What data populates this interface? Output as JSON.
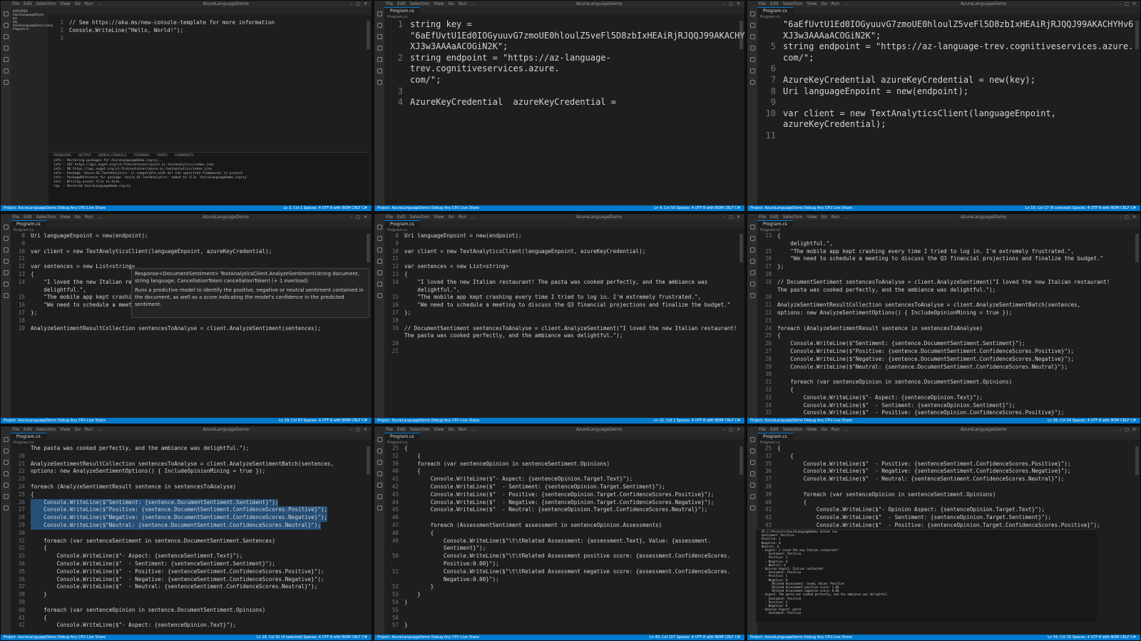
{
  "app": {
    "menu": [
      "File",
      "Edit",
      "Selection",
      "View",
      "Go",
      "Run",
      "..."
    ],
    "window_title": "AzureLanguageDemo",
    "file_tab": "Program.cs",
    "breadcrumb": "Program.cs"
  },
  "panes": [
    {
      "font": "small",
      "status_left": "Project: AzureLanguageDemo   Debug Any CPU   Live Share",
      "status_right": "Ln 3, Col 1   Spaces: 4   UTF-8 with BOM   CRLF   C#",
      "lines": [
        {
          "n": "1",
          "t": "// See https://aka.ms/new-console-template for more information"
        },
        {
          "n": "2",
          "t": "Console.WriteLine(\"Hello, World!\");"
        },
        {
          "n": "3",
          "t": ""
        }
      ]
    },
    {
      "font": "big",
      "status_left": "Project: AzureLanguageDemo   Debug Any CPU   Live Share",
      "status_right": "Ln 4, Col 50   Spaces: 4   UTF-8 with BOM   CRLF   C#",
      "lines": [
        {
          "n": "1",
          "t": "string key ="
        },
        {
          "n": "",
          "t": "\"6aEfUvtU1Ed0IOGyuuvG7zmoUE0hloulZ5veFl5D8zbIxHEAiRjRJQQJ99AKACHYHv6"
        },
        {
          "n": "",
          "t": "XJ3w3AAAaACOGiN2K\";"
        },
        {
          "n": "2",
          "t": "string endpoint = \"https://az-language-trev.cognitiveservices.azure."
        },
        {
          "n": "",
          "t": "com/\";"
        },
        {
          "n": "3",
          "t": ""
        },
        {
          "n": "4",
          "t": "AzureKeyCredential  azureKeyCredential = "
        }
      ]
    },
    {
      "font": "big",
      "status_left": "Project: AzureLanguageDemo   Debug Any CPU   Live Share",
      "status_right": "Ln 10, Col 17 (6 selected)   Spaces: 4   UTF-8 with BOM   CRLF   C#",
      "lines": [
        {
          "n": "",
          "t": "\"6aEfUvtU1Ed0IOGyuuvG7zmoUE0hloulZ5veFl5D8zbIxHEAiRjRJQQJ99AKACHYHv6"
        },
        {
          "n": "",
          "t": "XJ3w3AAAaACOGiN2K\";"
        },
        {
          "n": "5",
          "t": "string endpoint = \"https://az-language-trev.cognitiveservices.azure."
        },
        {
          "n": "",
          "t": "com/\";"
        },
        {
          "n": "6",
          "t": ""
        },
        {
          "n": "7",
          "t": "AzureKeyCredential azureKeyCredential = new(key);"
        },
        {
          "n": "8",
          "t": "Uri languageEnpoint = new(endpoint);"
        },
        {
          "n": "9",
          "t": ""
        },
        {
          "n": "10",
          "t": "var client = new TextAnalyticsClient(languageEnpoint,"
        },
        {
          "n": "",
          "t": "azureKeyCredential);"
        },
        {
          "n": "11",
          "t": ""
        }
      ]
    },
    {
      "font": "small",
      "status_left": "Project: AzureLanguageDemo   Debug Any CPU   Live Share",
      "status_right": "Ln 19, Col 97   Spaces: 4   UTF-8 with BOM   CRLF   C#",
      "lines": [
        {
          "n": "8",
          "t": "Uri languageEnpoint = new(endpoint);"
        },
        {
          "n": "9",
          "t": ""
        },
        {
          "n": "10",
          "t": "var client = new TextAnalyticsClient(languageEnpoint, azureKeyCredential);"
        },
        {
          "n": "11",
          "t": ""
        },
        {
          "n": "12",
          "t": "var sentences = new List<string>"
        },
        {
          "n": "13",
          "t": "{"
        },
        {
          "n": "14",
          "t": "    \"I loved the new Italian res"
        },
        {
          "n": "",
          "t": "    delightful.\","
        },
        {
          "n": "15",
          "t": "    \"The mobile app kept crashir"
        },
        {
          "n": "16",
          "t": "    \"We need to schedule a meeti"
        },
        {
          "n": "17",
          "t": "};"
        },
        {
          "n": "18",
          "t": ""
        },
        {
          "n": "19",
          "t": "AnalyzeSentimentResultCollection sentencesToAnalyse = client.AnalyzeSentiment(sentences);"
        }
      ]
    },
    {
      "font": "small",
      "status_left": "Project: AzureLanguageDemo   Debug Any CPU   Live Share",
      "status_right": "Ln 21, Col 1   Spaces: 4   UTF-8 with BOM   CRLF   C#",
      "lines": [
        {
          "n": "8",
          "t": "Uri languageEnpoint = new(endpoint);"
        },
        {
          "n": "9",
          "t": ""
        },
        {
          "n": "10",
          "t": "var client = new TextAnalyticsClient(languageEnpoint, azureKeyCredential);"
        },
        {
          "n": "11",
          "t": ""
        },
        {
          "n": "12",
          "t": "var sentences = new List<string>"
        },
        {
          "n": "13",
          "t": "{"
        },
        {
          "n": "14",
          "t": "    \"I loved the new Italian restaurant! The pasta was cooked perfectly, and the ambiance was"
        },
        {
          "n": "",
          "t": "    delightful.\","
        },
        {
          "n": "15",
          "t": "    \"The mobile app kept crashing every time I tried to log in. I'm extremely frustrated.\","
        },
        {
          "n": "16",
          "t": "    \"We need to schedule a meeting to discuss the Q3 financial projections and finalize the budget.\""
        },
        {
          "n": "17",
          "t": "};"
        },
        {
          "n": "18",
          "t": ""
        },
        {
          "n": "19",
          "t": "// DocumentSentiment sentencesToAnalyse = client.AnalyzeSentiment(\"I loved the new Italian restaurant!"
        },
        {
          "n": "",
          "t": "The pasta was cooked perfectly, and the ambiance was delightful.\");"
        },
        {
          "n": "20",
          "t": ""
        },
        {
          "n": "21",
          "t": ""
        }
      ]
    },
    {
      "font": "small",
      "status_left": "Project: AzureLanguageDemo   Debug Any CPU   Live Share",
      "status_right": "Ln 26, Col 54   Spaces: 4   UTF-8 with BOM   CRLF   C#",
      "lines": [
        {
          "n": "13",
          "t": "{"
        },
        {
          "n": "",
          "t": "    delightful.\","
        },
        {
          "n": "15",
          "t": "    \"The mobile app kept crashing every time I tried to log in. I'm extremely frustrated.\","
        },
        {
          "n": "16",
          "t": "    \"We need to schedule a meeting to discuss the Q3 financial projections and finalize the budget.\""
        },
        {
          "n": "17",
          "t": "};"
        },
        {
          "n": "18",
          "t": ""
        },
        {
          "n": "19",
          "t": "// DocumentSentiment sentencesToAnalyse = client.AnalyzeSentiment(\"I loved the new Italian restaurant!"
        },
        {
          "n": "",
          "t": "The pasta was cooked perfectly, and the ambiance was delightful.\");"
        },
        {
          "n": "20",
          "t": ""
        },
        {
          "n": "21",
          "t": "AnalyzeSentimentResultCollection sentencesToAnalyse = client.AnalyzeSentimentBatch(sentences,"
        },
        {
          "n": "22",
          "t": "options: new AnalyzeSentimentOptions() { IncludeOpinionMining = true });"
        },
        {
          "n": "23",
          "t": ""
        },
        {
          "n": "24",
          "t": "foreach (AnalyzeSentimentResult sentence in sentencesToAnalyse)"
        },
        {
          "n": "25",
          "t": "{"
        },
        {
          "n": "26",
          "t": "    Console.WriteLine($\"Sentiment: {sentence.DocumentSentiment.Sentiment}\");"
        },
        {
          "n": "27",
          "t": "    Console.WriteLine($\"Positive: {sentence.DocumentSentiment.ConfidenceScores.Positive}\");"
        },
        {
          "n": "28",
          "t": "    Console.WriteLine($\"Negative: {sentence.DocumentSentiment.ConfidenceScores.Negative}\");"
        },
        {
          "n": "29",
          "t": "    Console.WriteLine($\"Neutral: {sentence.DocumentSentiment.ConfidenceScores.Neutral}\");"
        },
        {
          "n": "30",
          "t": ""
        },
        {
          "n": "31",
          "t": "    foreach (var sentenceOpinion in sentence.DocumentSentiment.Opinions)"
        },
        {
          "n": "32",
          "t": "    {"
        },
        {
          "n": "33",
          "t": "        Console.WriteLine($\"- Aspect: {sentenceOpinion.Text}\");"
        },
        {
          "n": "34",
          "t": "        Console.WriteLine($\"  - Sentiment: {sentenceOpinion.Sentiment}\");"
        },
        {
          "n": "35",
          "t": "        Console.WriteLine($\"  - Positive: {sentenceOpinion.ConfidenceScores.Positive}\");"
        }
      ]
    },
    {
      "font": "small",
      "status_left": "Project: AzureLanguageDemo   Debug Any CPU   Live Share",
      "status_right": "Ln 29, Col 91 (4 selected)   Spaces: 4   UTF-8 with BOM   CRLF   C#",
      "lines": [
        {
          "n": "",
          "t": "The pasta was cooked perfectly, and the ambiance was delightful.\");"
        },
        {
          "n": "20",
          "t": ""
        },
        {
          "n": "21",
          "t": "AnalyzeSentimentResultCollection sentencesToAnalyse = client.AnalyzeSentimentBatch(sentences,"
        },
        {
          "n": "22",
          "t": "options: new AnalyzeSentimentOptions() { IncludeOpinionMining = true });"
        },
        {
          "n": "23",
          "t": ""
        },
        {
          "n": "24",
          "t": "foreach (AnalyzeSentimentResult sentence in sentencesToAnalyse)"
        },
        {
          "n": "25",
          "t": "{"
        },
        {
          "n": "26",
          "t": "    Console.WriteLine($\"Sentiment: {sentence.DocumentSentiment.Sentiment}\");",
          "hl": true
        },
        {
          "n": "27",
          "t": "    Console.WriteLine($\"Positive: {sentence.DocumentSentiment.ConfidenceScores.Positive}\");",
          "hl": true
        },
        {
          "n": "28",
          "t": "    Console.WriteLine($\"Negative: {sentence.DocumentSentiment.ConfidenceScores.Negative}\");",
          "hl": true
        },
        {
          "n": "29",
          "t": "    Console.WriteLine($\"Neutral: {sentence.DocumentSentiment.ConfidenceScores.Neutral}\");",
          "hl": true
        },
        {
          "n": "30",
          "t": ""
        },
        {
          "n": "31",
          "t": "    foreach (var sentenceSentiment in sentence.DocumentSentiment.Sentences)"
        },
        {
          "n": "32",
          "t": "    {"
        },
        {
          "n": "33",
          "t": "        Console.WriteLine($\"- Aspect: {sentenceSentiment.Text}\");"
        },
        {
          "n": "34",
          "t": "        Console.WriteLine($\"  - Sentiment: {sentenceSentiment.Sentiment}\");"
        },
        {
          "n": "35",
          "t": "        Console.WriteLine($\"  - Positive: {sentenceSentiment.ConfidenceScores.Positive}\");"
        },
        {
          "n": "36",
          "t": "        Console.WriteLine($\"  - Negative: {sentenceSentiment.ConfidenceScores.Negative}\");"
        },
        {
          "n": "37",
          "t": "        Console.WriteLine($\"  - Neutral: {sentenceSentiment.ConfidenceScores.Neutral}\");"
        },
        {
          "n": "38",
          "t": "    }"
        },
        {
          "n": "39",
          "t": ""
        },
        {
          "n": "40",
          "t": "    foreach (var sentenceOpinion in sentence.DocumentSentiment.Opinions)"
        },
        {
          "n": "41",
          "t": "    {"
        },
        {
          "n": "42",
          "t": "        Console.WriteLine($\"- Aspect: {sentenceOpinion.Text}\");"
        }
      ]
    },
    {
      "font": "small",
      "status_left": "Project: AzureLanguageDemo   Debug Any CPU   Live Share",
      "status_right": "Ln 49, Col 107   Spaces: 4   UTF-8 with BOM   CRLF   C#",
      "lines": [
        {
          "n": "25",
          "t": "{"
        },
        {
          "n": "32",
          "t": "    {"
        },
        {
          "n": "39",
          "t": "    foreach (var sentenceOpinion in sentenceSentiment.Opinions)"
        },
        {
          "n": "40",
          "t": "    {"
        },
        {
          "n": "41",
          "t": "        Console.WriteLine($\"- Aspect: {sentenceOpinion.Target.Text}\");"
        },
        {
          "n": "42",
          "t": "        Console.WriteLine($\"  - Sentiment: {sentenceOpinion.Target.Sentiment}\");"
        },
        {
          "n": "43",
          "t": "        Console.WriteLine($\"  - Positive: {sentenceOpinion.Target.ConfidenceScores.Positive}\");"
        },
        {
          "n": "44",
          "t": "        Console.WriteLine($\"  - Negative: {sentenceOpinion.Target.ConfidenceScores.Negative}\");"
        },
        {
          "n": "45",
          "t": "        Console.WriteLine($\"  - Neutral: {sentenceOpinion.Target.ConfidenceScores.Neutral}\");"
        },
        {
          "n": "46",
          "t": ""
        },
        {
          "n": "47",
          "t": "        foreach (AssessmentSentiment assessment in sentenceOpinion.Assessments)"
        },
        {
          "n": "48",
          "t": "        {"
        },
        {
          "n": "49",
          "t": "            Console.WriteLine($\"\\t\\tRelated Assessment: {assessment.Text}, Value: {assessment."
        },
        {
          "n": "",
          "t": "            Sentiment}\");"
        },
        {
          "n": "50",
          "t": "            Console.WriteLine($\"\\t\\tRelated Assessment positive score: {assessment.ConfidenceScores."
        },
        {
          "n": "",
          "t": "            Positive:0.00}\");"
        },
        {
          "n": "51",
          "t": "            Console.WriteLine($\"\\t\\tRelated Assessment negative score: {assessment.ConfidenceScores."
        },
        {
          "n": "",
          "t": "            Negative:0.00}\");"
        },
        {
          "n": "52",
          "t": "        }"
        },
        {
          "n": "53",
          "t": "    }"
        },
        {
          "n": "54",
          "t": "}"
        },
        {
          "n": "55",
          "t": ""
        },
        {
          "n": "56",
          "t": ""
        },
        {
          "n": "57",
          "t": "}"
        }
      ]
    },
    {
      "font": "small",
      "status_left": "Project: AzureLanguageDemo   Debug Any CPU   Live Share",
      "status_right": "Ln 34, Col 25   Spaces: 4   UTF-8 with BOM   CRLF   C#",
      "lines": [
        {
          "n": "25",
          "t": "{"
        },
        {
          "n": "32",
          "t": "    {"
        },
        {
          "n": "35",
          "t": "        Console.WriteLine($\"  - Positive: {sentenceSentiment.ConfidenceScores.Positive}\");"
        },
        {
          "n": "36",
          "t": "        Console.WriteLine($\"  - Negative: {sentenceSentiment.ConfidenceScores.Negative}\");"
        },
        {
          "n": "37",
          "t": "        Console.WriteLine($\"  - Neutral: {sentenceSentiment.ConfidenceScores.Neutral}\");"
        },
        {
          "n": "38",
          "t": ""
        },
        {
          "n": "39",
          "t": "        foreach (var sentenceOpinion in sentenceSentiment.Opinions)"
        },
        {
          "n": "40",
          "t": "        {"
        },
        {
          "n": "41",
          "t": "            Console.WriteLine($\"- Opinion Aspect: {sentenceOpinion.Target.Text}\");"
        },
        {
          "n": "42",
          "t": "            Console.WriteLine($\"  - Sentiment: {sentenceOpinion.Target.Sentiment}\");"
        },
        {
          "n": "43",
          "t": "            Console.WriteLine($\"  - Positive: {sentenceOpinion.Target.ConfidenceScores.Positive}\");"
        }
      ]
    }
  ],
  "hover": {
    "signature": "Response<DocumentSentiment> TextAnalyticsClient.AnalyzeSentiment(string document, string language, CancellationToken cancellationToken) (+ 1 overload)",
    "description": "Runs a predictive model to identify the positive, negative or neutral sentiment contained in the document, as well as a score indicating the model's confidence in the predicted sentiment."
  },
  "explorer": {
    "title": "EXPLORER",
    "items": [
      "AzureLanguageDemo",
      "bin",
      "obj",
      "AzureLanguageDemo.csproj",
      "Program.cs"
    ]
  },
  "output_panel": {
    "tabs": [
      "PROBLEMS",
      "OUTPUT",
      "DEBUG CONSOLE",
      "TERMINAL",
      "PORTS",
      "COMMENTS"
    ],
    "lines": [
      "info : Restoring packages for AzureLanguageDemo.csproj...",
      "info : GET https://api.nuget.org/v3-flatcontainer/azure.ai.textanalytics/index.json",
      "info : OK https://api.nuget.org/v3-flatcontainer/azure.ai.textanalytics/index.json",
      "info : Package 'Azure.AI.TextAnalytics' is compatible with all the specified frameworks in project",
      "info : PackageReference for package 'Azure.AI.TextAnalytics' added to file 'AzureLanguageDemo.csproj'.",
      "info : Writing assets file to disk.",
      "log  : Restored AzureLanguageDemo.csproj"
    ]
  },
  "terminal": {
    "lines": [
      "PS C:\\Projects\\AzureLanguageDemo> dotnet run",
      "Sentiment: Positive",
      "Positive: 1",
      "Negative: 0",
      "Neutral: 0",
      "- Aspect: I loved the new Italian restaurant!",
      "  - Sentiment: Positive",
      "  - Positive: 1",
      "  - Negative: 0",
      "  - Neutral: 0",
      "- Opinion Aspect: Italian restaurant",
      "  - Sentiment: Positive",
      "  - Positive: 1",
      "  - Negative: 0",
      "      Related Assessment: loved, Value: Positive",
      "      Related Assessment positive score: 1.00",
      "      Related Assessment negative score: 0.00",
      "- Aspect: The pasta was cooked perfectly, and the ambiance was delightful.",
      "  - Sentiment: Positive",
      "  - Positive: 1",
      "  - Negative: 0",
      "- Opinion Aspect: pasta",
      "  - Sentiment: Positive"
    ]
  }
}
